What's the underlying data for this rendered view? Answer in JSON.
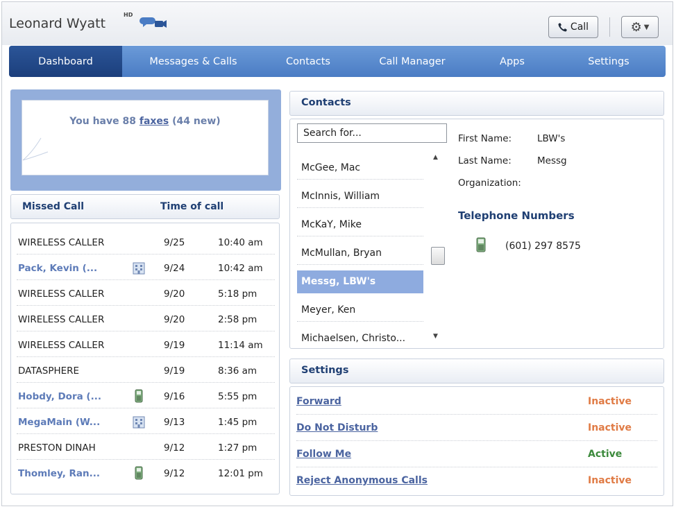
{
  "header": {
    "user_name": "Leonard Wyatt",
    "hd_badge": "HD",
    "call_button_label": "Call"
  },
  "nav": {
    "tabs": [
      {
        "label": "Dashboard",
        "active": true
      },
      {
        "label": "Messages & Calls"
      },
      {
        "label": "Contacts"
      },
      {
        "label": "Call Manager"
      },
      {
        "label": "Apps"
      },
      {
        "label": "Settings"
      }
    ]
  },
  "fax": {
    "prefix": "You have 88 ",
    "link": "faxes",
    "suffix": " (44 new)"
  },
  "missed_calls": {
    "columns": [
      "Missed Call",
      "Time of call"
    ],
    "rows": [
      {
        "name": "WIRELESS CALLER",
        "date": "9/25",
        "time": "10:40 am"
      },
      {
        "name": "Pack, Kevin (...",
        "date": "9/24",
        "time": "10:42 am",
        "link": true,
        "icon": "building-icon"
      },
      {
        "name": "WIRELESS CALLER",
        "date": "9/20",
        "time": "5:18 pm"
      },
      {
        "name": "WIRELESS CALLER",
        "date": "9/20",
        "time": "2:58 pm"
      },
      {
        "name": "WIRELESS CALLER",
        "date": "9/19",
        "time": "11:14 am"
      },
      {
        "name": "DATASPHERE",
        "date": "9/19",
        "time": "8:36 am"
      },
      {
        "name": "Hobdy, Dora (...",
        "date": "9/16",
        "time": "5:55 pm",
        "link": true,
        "icon": "mobile-phone-icon"
      },
      {
        "name": "MegaMain (W...",
        "date": "9/13",
        "time": "1:45 pm",
        "link": true,
        "icon": "building-icon"
      },
      {
        "name": "PRESTON DINAH",
        "date": "9/12",
        "time": "1:27 pm"
      },
      {
        "name": "Thomley, Ran...",
        "date": "9/12",
        "time": "12:01 pm",
        "link": true,
        "icon": "mobile-phone-icon"
      }
    ]
  },
  "contacts": {
    "title": "Contacts",
    "search_value": "Search for...",
    "list": [
      {
        "name": "McGee, Mac"
      },
      {
        "name": "McInnis, William"
      },
      {
        "name": "McKaY, Mike"
      },
      {
        "name": "McMullan, Bryan"
      },
      {
        "name": "Messg, LBW's",
        "selected": true
      },
      {
        "name": "Meyer, Ken"
      },
      {
        "name": "Michaelsen, Christo..."
      }
    ],
    "details": {
      "first_name_label": "First Name:",
      "first_name_value": "LBW's",
      "last_name_label": "Last Name:",
      "last_name_value": "Messg",
      "organization_label": "Organization:",
      "telephone_title": "Telephone Numbers",
      "phone": "(601) 297 8575"
    }
  },
  "settings": {
    "title": "Settings",
    "items": [
      {
        "label": "Forward",
        "status": "Inactive"
      },
      {
        "label": "Do Not Disturb",
        "status": "Inactive"
      },
      {
        "label": "Follow Me",
        "status": "Active"
      },
      {
        "label": "Reject Anonymous Calls",
        "status": "Inactive"
      }
    ]
  },
  "colors": {
    "nav_bg": "#5a8ad0",
    "nav_active": "#244b8a",
    "heading": "#1f3f73",
    "link": "#4b64a0",
    "inactive": "#e07b45",
    "active": "#3c8a3c",
    "selected_row": "#8eabdf"
  }
}
